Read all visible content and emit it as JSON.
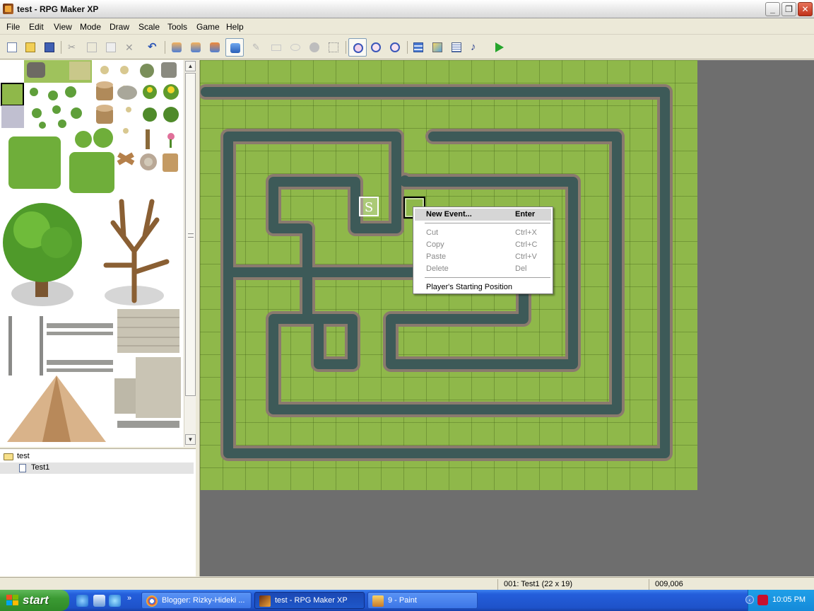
{
  "window": {
    "title": "test - RPG Maker XP",
    "controls": [
      "minimize",
      "restore",
      "close"
    ]
  },
  "menubar": [
    "File",
    "Edit",
    "View",
    "Mode",
    "Draw",
    "Scale",
    "Tools",
    "Game",
    "Help"
  ],
  "toolbar": {
    "icons": [
      "new-project-icon",
      "open-project-icon",
      "save-icon",
      "cut-icon",
      "copy-icon",
      "paste-icon",
      "delete-icon",
      "undo-icon",
      "layer1-icon",
      "layer2-icon",
      "layer3-icon",
      "event-layer-icon",
      "pencil-icon",
      "rectangle-icon",
      "ellipse-icon",
      "fill-icon",
      "select-icon",
      "zoom-1-1-icon",
      "zoom-1-2-icon",
      "zoom-1-4-icon",
      "database-icon",
      "materialbase-icon",
      "script-editor-icon",
      "sound-test-icon",
      "playtest-icon"
    ],
    "pressed": [
      "event-layer-icon",
      "zoom-1-1-icon"
    ]
  },
  "map_tree": {
    "root": "test",
    "maps": [
      "Test1"
    ],
    "selected": "Test1"
  },
  "map": {
    "start_marker": "S"
  },
  "context_menu": {
    "items": [
      {
        "label": "New Event...",
        "shortcut": "Enter",
        "highlighted": true,
        "disabled": false
      },
      {
        "label": "Cut",
        "shortcut": "Ctrl+X",
        "disabled": true
      },
      {
        "label": "Copy",
        "shortcut": "Ctrl+C",
        "disabled": true
      },
      {
        "label": "Paste",
        "shortcut": "Ctrl+V",
        "disabled": true
      },
      {
        "label": "Delete",
        "shortcut": "Del",
        "disabled": true
      },
      {
        "label": "Player's Starting Position",
        "shortcut": "",
        "disabled": false
      }
    ]
  },
  "statusbar": {
    "map_info": "001: Test1 (22 x 19)",
    "coords": "009,006"
  },
  "taskbar": {
    "start": "start",
    "tasks": [
      {
        "label": "Blogger: Rizky-Hideki ...",
        "icon": "chrome-icon",
        "active": false
      },
      {
        "label": "test - RPG Maker XP",
        "icon": "rpgmaker-icon",
        "active": true
      },
      {
        "label": "9 - Paint",
        "icon": "paint-icon",
        "active": false
      }
    ],
    "clock": "10:05 PM"
  },
  "colors": {
    "grass": "#8fb84a",
    "water": "#3d5a58",
    "rock": "#8a7a6e",
    "void": "#6e6e6e"
  }
}
